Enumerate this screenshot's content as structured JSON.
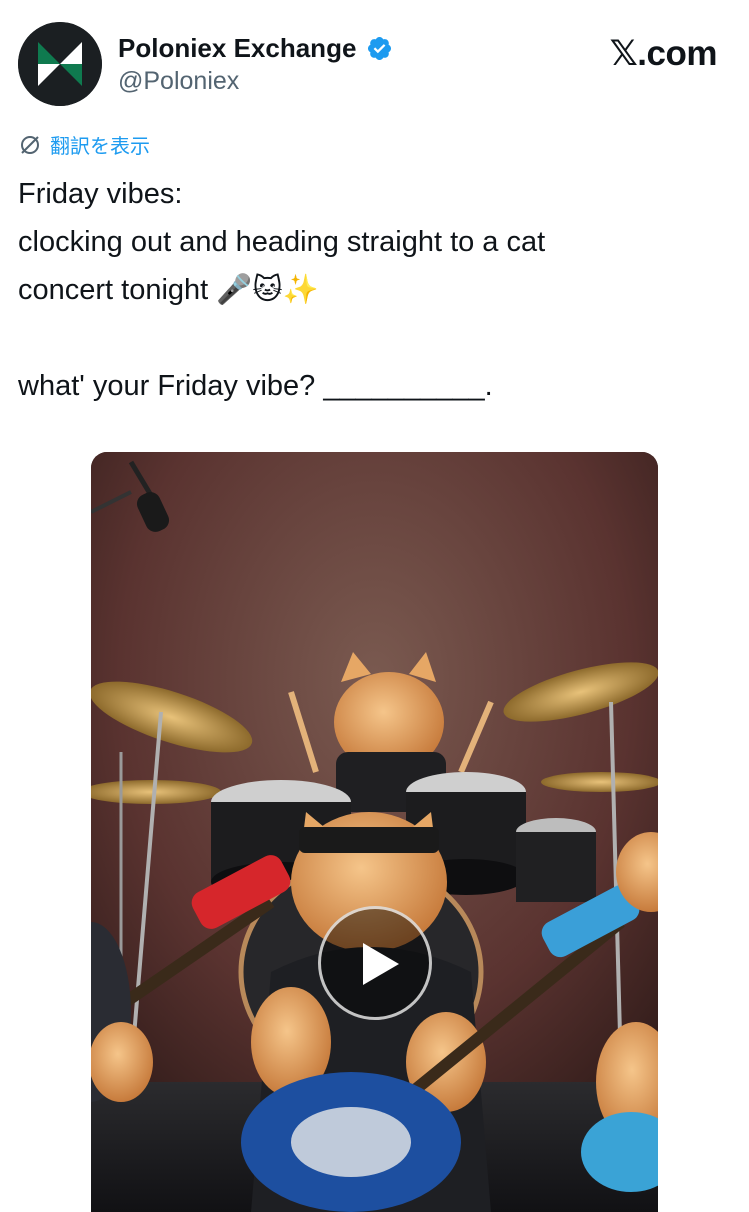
{
  "author": {
    "display_name": "Poloniex Exchange",
    "handle": "@Poloniex",
    "verified": true,
    "avatar_icon": "poloniex-logo-icon"
  },
  "brand": "𝕏.com",
  "translate_label": "翻訳を表示",
  "tweet": {
    "lines": [
      "Friday vibes:",
      "clocking out and heading straight to a cat",
      "concert tonight 🎤🐱✨",
      "",
      "what' your Friday vibe? __________."
    ]
  },
  "media": {
    "type": "video",
    "play_icon": "play-icon"
  },
  "colors": {
    "accent": "#1d9bf0",
    "text": "#0f1419",
    "secondary_text": "#536471"
  }
}
